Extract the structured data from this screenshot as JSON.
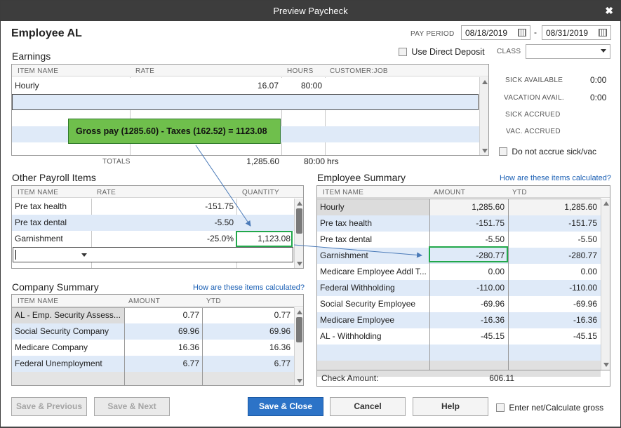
{
  "window": {
    "title": "Preview Paycheck",
    "close_glyph": "✖"
  },
  "employee": {
    "name": "Employee AL"
  },
  "pay_period": {
    "label": "PAY PERIOD",
    "start": "08/18/2019",
    "end": "08/31/2019",
    "separator": "-"
  },
  "direct_deposit": {
    "label": "Use Direct Deposit"
  },
  "class_field": {
    "label": "CLASS",
    "value": ""
  },
  "earnings": {
    "title": "Earnings",
    "columns": [
      "ITEM NAME",
      "RATE",
      "HOURS",
      "CUSTOMER:JOB"
    ],
    "rows": [
      {
        "item": "Hourly",
        "rate": "16.07",
        "hours": "80:00",
        "customer": ""
      }
    ],
    "totals_label": "TOTALS",
    "total_amount": "1,285.60",
    "total_hours": "80:00",
    "hours_unit": "hrs"
  },
  "sick_vac": {
    "sick_available_label": "SICK AVAILABLE",
    "sick_available": "0:00",
    "vac_available_label": "VACATION AVAIL.",
    "vac_available": "0:00",
    "sick_accrued_label": "SICK ACCRUED",
    "vac_accrued_label": "VAC. ACCRUED",
    "no_accrue_label": "Do not accrue sick/vac"
  },
  "callout": {
    "text": "Gross pay (1285.60)  - Taxes (162.52)  = 1123.08"
  },
  "other_payroll": {
    "title": "Other Payroll Items",
    "columns": [
      "ITEM NAME",
      "RATE",
      "QUANTITY"
    ],
    "rows": [
      {
        "item": "Pre tax health",
        "rate": "-151.75",
        "qty": ""
      },
      {
        "item": "Pre tax dental",
        "rate": "-5.50",
        "qty": ""
      },
      {
        "item": "Garnishment",
        "rate": "-25.0%",
        "qty": "1,123.08"
      }
    ]
  },
  "company_summary": {
    "title": "Company Summary",
    "link": "How are these items calculated?",
    "columns": [
      "ITEM NAME",
      "AMOUNT",
      "YTD"
    ],
    "rows": [
      {
        "item": "AL - Emp. Security Assess...",
        "amount": "0.77",
        "ytd": "0.77"
      },
      {
        "item": "Social Security Company",
        "amount": "69.96",
        "ytd": "69.96"
      },
      {
        "item": "Medicare Company",
        "amount": "16.36",
        "ytd": "16.36"
      },
      {
        "item": "Federal Unemployment",
        "amount": "6.77",
        "ytd": "6.77"
      }
    ]
  },
  "employee_summary": {
    "title": "Employee Summary",
    "link": "How are these items calculated?",
    "columns": [
      "ITEM NAME",
      "AMOUNT",
      "YTD"
    ],
    "rows": [
      {
        "item": "Hourly",
        "amount": "1,285.60",
        "ytd": "1,285.60"
      },
      {
        "item": "Pre tax health",
        "amount": "-151.75",
        "ytd": "-151.75"
      },
      {
        "item": "Pre tax dental",
        "amount": "-5.50",
        "ytd": "-5.50"
      },
      {
        "item": "Garnishment",
        "amount": "-280.77",
        "ytd": "-280.77"
      },
      {
        "item": "Medicare Employee Addl T...",
        "amount": "0.00",
        "ytd": "0.00"
      },
      {
        "item": "Federal Withholding",
        "amount": "-110.00",
        "ytd": "-110.00"
      },
      {
        "item": "Social Security Employee",
        "amount": "-69.96",
        "ytd": "-69.96"
      },
      {
        "item": "Medicare Employee",
        "amount": "-16.36",
        "ytd": "-16.36"
      },
      {
        "item": "AL - Withholding",
        "amount": "-45.15",
        "ytd": "-45.15"
      }
    ],
    "check_amount_label": "Check Amount:",
    "check_amount": "606.11"
  },
  "buttons": {
    "save_previous": "Save & Previous",
    "save_next": "Save & Next",
    "save_close": "Save & Close",
    "cancel": "Cancel",
    "help": "Help",
    "enter_net_label": "Enter net/Calculate gross"
  },
  "colors": {
    "titlebar": "#3d3d3d",
    "row_blue": "#dfeaf8",
    "callout_green": "#6fbf4c",
    "highlight_green": "#22a84b",
    "primary_button": "#2c73c7",
    "link": "#1a5fb4"
  }
}
